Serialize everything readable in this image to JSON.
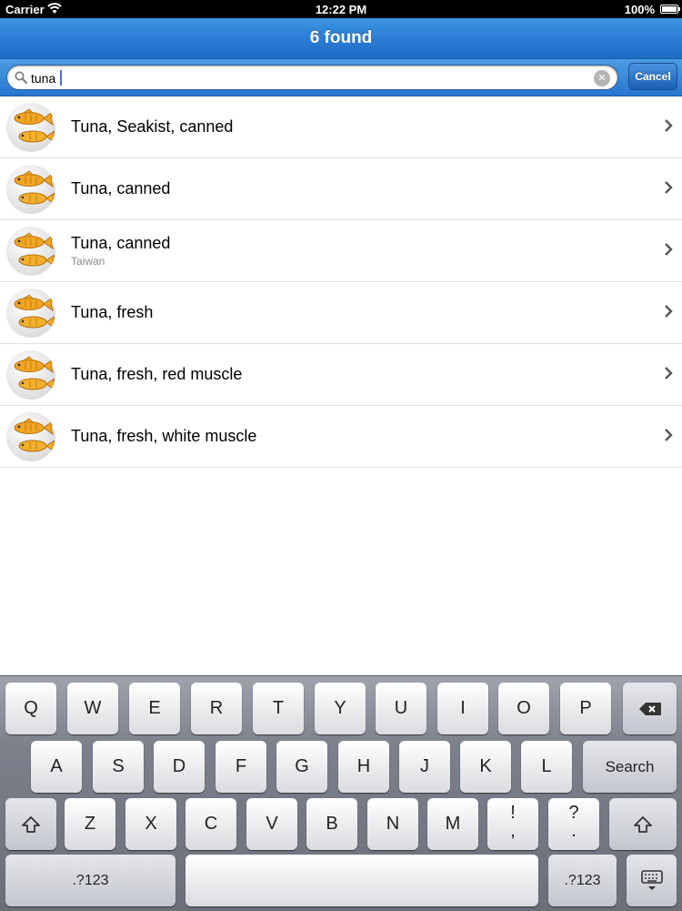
{
  "status_bar": {
    "carrier": "Carrier",
    "time": "12:22 PM",
    "battery": "100%"
  },
  "nav": {
    "title": "6 found"
  },
  "search": {
    "value": "tuna",
    "cancel_label": "Cancel",
    "clear_icon": "×"
  },
  "results": [
    {
      "title": "Tuna, Seakist, canned",
      "subtitle": ""
    },
    {
      "title": "Tuna, canned",
      "subtitle": ""
    },
    {
      "title": "Tuna, canned",
      "subtitle": "Taiwan"
    },
    {
      "title": "Tuna, fresh",
      "subtitle": ""
    },
    {
      "title": "Tuna, fresh, red muscle",
      "subtitle": ""
    },
    {
      "title": "Tuna, fresh, white muscle",
      "subtitle": ""
    }
  ],
  "keyboard": {
    "row1": [
      "Q",
      "W",
      "E",
      "R",
      "T",
      "Y",
      "U",
      "I",
      "O",
      "P"
    ],
    "row2": [
      "A",
      "S",
      "D",
      "F",
      "G",
      "H",
      "J",
      "K",
      "L"
    ],
    "row3": [
      "Z",
      "X",
      "C",
      "V",
      "B",
      "N",
      "M"
    ],
    "exclaim_top": "!",
    "exclaim_bottom": ",",
    "question_top": "?",
    "question_bottom": ".",
    "search_label": "Search",
    "numbers_label": ".?123"
  },
  "icons": {
    "wifi": "wifi-icon",
    "battery": "battery-icon",
    "search": "search-icon",
    "chevron": "chevron-right-icon",
    "backspace": "backspace-icon",
    "shift": "shift-icon",
    "dismiss_keyboard": "keyboard-dismiss-icon",
    "thumbnail": "fish-icon"
  },
  "colors": {
    "nav_blue": "#2a7bd3",
    "cursor": "#4a6fe0",
    "subtitle_gray": "#8a8a8a"
  }
}
